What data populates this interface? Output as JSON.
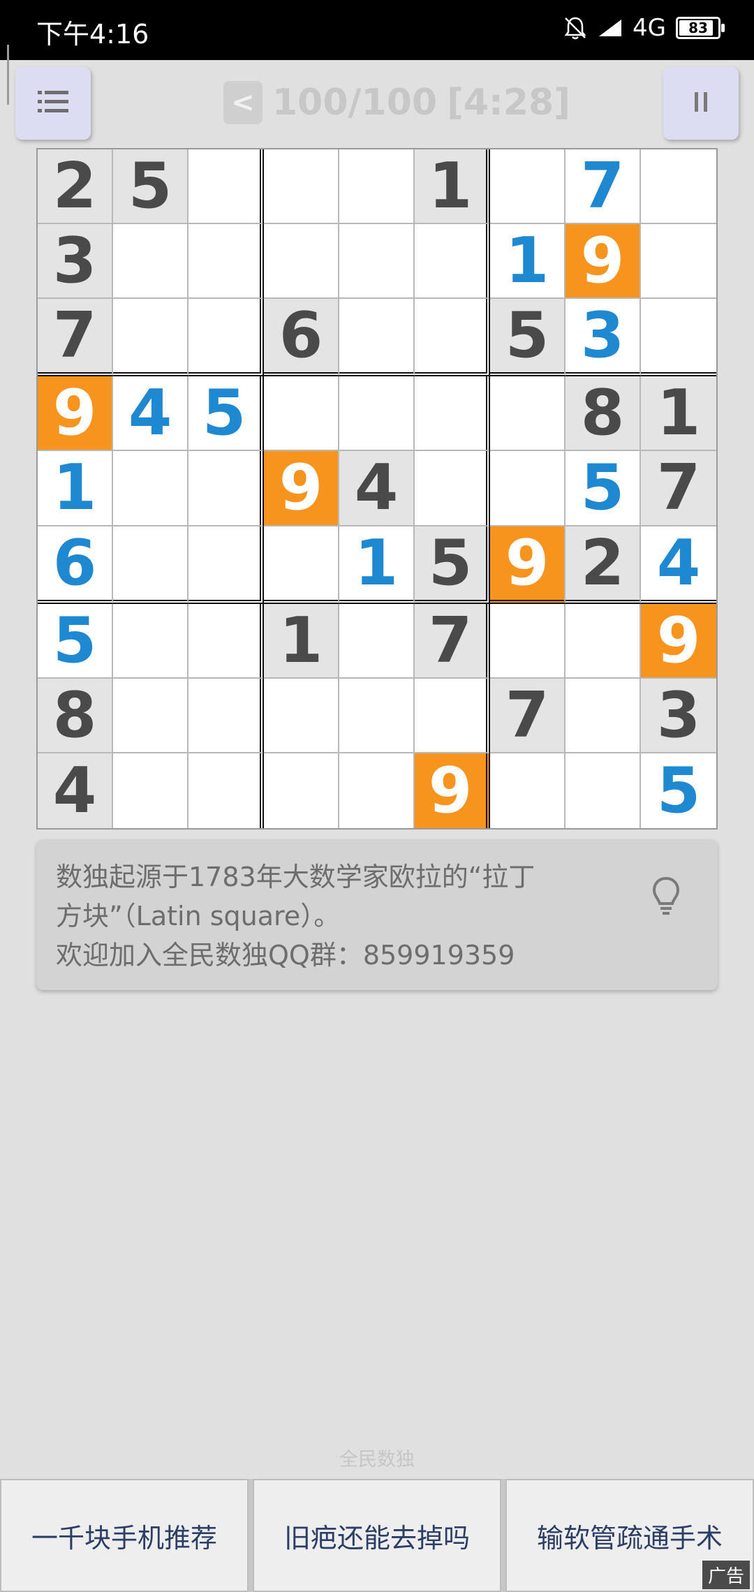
{
  "status_bar": {
    "time": "下午4:16",
    "network": "4G",
    "battery": "83"
  },
  "header": {
    "back_label": "<",
    "progress": "100/100",
    "timer": "[4:28]"
  },
  "board": {
    "rows": [
      [
        "2",
        "5",
        "",
        "",
        "",
        "1",
        "",
        "7",
        ""
      ],
      [
        "3",
        "",
        "",
        "",
        "",
        "",
        "1",
        "9",
        ""
      ],
      [
        "7",
        "",
        "",
        "6",
        "",
        "",
        "5",
        "3",
        ""
      ],
      [
        "9",
        "4",
        "5",
        "",
        "",
        "",
        "",
        "8",
        "1"
      ],
      [
        "1",
        "",
        "",
        "9",
        "4",
        "",
        "",
        "5",
        "7"
      ],
      [
        "6",
        "",
        "",
        "",
        "1",
        "5",
        "9",
        "2",
        "4"
      ],
      [
        "5",
        "",
        "",
        "1",
        "",
        "7",
        "",
        "",
        "9"
      ],
      [
        "8",
        "",
        "",
        "",
        "",
        "",
        "7",
        "",
        "3"
      ],
      [
        "4",
        "",
        "",
        "",
        "",
        "9",
        "",
        "",
        "5"
      ]
    ],
    "given": [
      [
        1,
        1,
        0,
        0,
        0,
        1,
        0,
        0,
        0
      ],
      [
        1,
        0,
        0,
        0,
        0,
        0,
        0,
        0,
        0
      ],
      [
        1,
        0,
        0,
        1,
        0,
        0,
        1,
        0,
        0
      ],
      [
        0,
        0,
        0,
        0,
        0,
        0,
        0,
        1,
        1
      ],
      [
        0,
        0,
        0,
        0,
        1,
        0,
        0,
        0,
        1
      ],
      [
        0,
        0,
        0,
        0,
        0,
        1,
        0,
        1,
        0
      ],
      [
        0,
        0,
        0,
        1,
        0,
        1,
        0,
        0,
        0
      ],
      [
        1,
        0,
        0,
        0,
        0,
        0,
        1,
        0,
        1
      ],
      [
        1,
        0,
        0,
        0,
        0,
        0,
        0,
        0,
        0
      ]
    ],
    "highlighted_digit": "9",
    "colors": {
      "given_text": "#4a4a4a",
      "user_text": "#1e88d0",
      "highlight": "#f7941d"
    }
  },
  "tip": {
    "line1": "数独起源于1783年大数学家欧拉的“拉丁",
    "line2": "方块”（Latin square）。",
    "line3": "欢迎加入全民数独QQ群：859919359"
  },
  "brand": "全民数独",
  "ads": {
    "items": [
      "一千块手机推荐",
      "旧疤还能去掉吗",
      "输软管疏通手术"
    ],
    "tag": "广告"
  }
}
